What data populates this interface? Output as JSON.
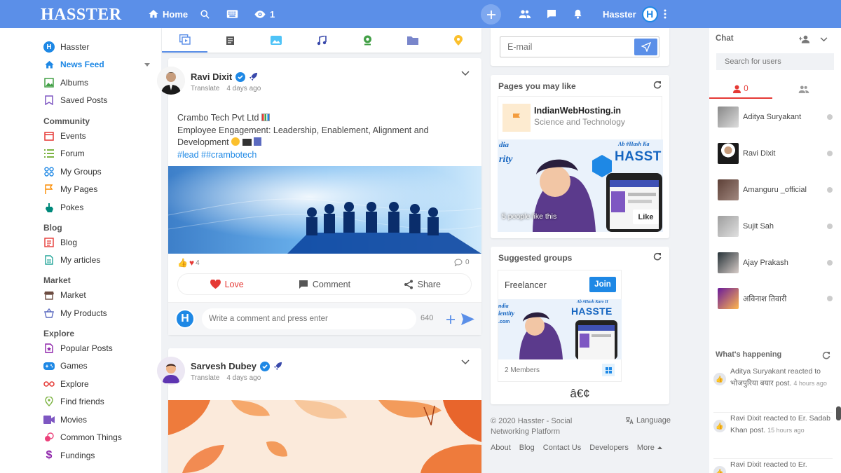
{
  "app": {
    "brand": "HASSTER"
  },
  "topbar": {
    "home_label": "Home",
    "views_count": "1",
    "user_name": "Hasster",
    "user_initial": "H"
  },
  "sidebar": {
    "profile": "Hasster",
    "news_feed": "News Feed",
    "albums": "Albums",
    "saved_posts": "Saved Posts",
    "community_heading": "Community",
    "events": "Events",
    "forum": "Forum",
    "my_groups": "My Groups",
    "my_pages": "My Pages",
    "pokes": "Pokes",
    "blog_heading": "Blog",
    "blog": "Blog",
    "my_articles": "My articles",
    "market_heading": "Market",
    "market": "Market",
    "my_products": "My Products",
    "explore_heading": "Explore",
    "popular_posts": "Popular Posts",
    "games": "Games",
    "explore": "Explore",
    "find_friends": "Find friends",
    "movies": "Movies",
    "common_things": "Common Things",
    "fundings": "Fundings"
  },
  "post1": {
    "author": "Ravi Dixit",
    "translate": "Translate",
    "time": "4 days ago",
    "line1": "Crambo Tech Pvt Ltd",
    "line2": "Employee Engagement: Leadership, Enablement, Alignment and",
    "line3": "Development",
    "hashtags": "#lead ##crambotech",
    "reaction_count": "4",
    "comment_count": "0",
    "love_label": "Love",
    "comment_label": "Comment",
    "share_label": "Share",
    "comment_placeholder": "Write a comment and press enter",
    "char_count": "640"
  },
  "post2": {
    "author": "Sarvesh Dubey",
    "translate": "Translate",
    "time": "4 days ago"
  },
  "email_box": {
    "placeholder": "E-mail"
  },
  "pages_like": {
    "title": "Pages you may like",
    "page_name": "IndianWebHosting.in",
    "page_category": "Science and Technology",
    "likes_text": "5 people like this",
    "like_button": "Like",
    "banner_tag": "Ab #Hash Ka",
    "banner_brand": "HASST",
    "banner_side1": "dia",
    "banner_side2": "rity"
  },
  "suggested_groups": {
    "title": "Suggested groups",
    "group_name": "Freelancer",
    "join_button": "Join",
    "members": "2 Members",
    "garbled": "â€¢",
    "banner_tag": "Ab #Hash Karo H",
    "banner_brand": "HASSTE",
    "banner_side1": "ndia",
    "banner_side2": "ientity",
    "banner_side3": ".com"
  },
  "footer": {
    "copyright": "© 2020 Hasster - Social Networking Platform",
    "language": "Language",
    "about": "About",
    "blog": "Blog",
    "contact": "Contact Us",
    "developers": "Developers",
    "more": "More"
  },
  "chat": {
    "title": "Chat",
    "search_placeholder": "Search for users",
    "online_count": "0",
    "users": [
      {
        "name": "Aditya Suryakant"
      },
      {
        "name": "Ravi Dixit"
      },
      {
        "name": "Amanguru _official"
      },
      {
        "name": "Sujit Sah"
      },
      {
        "name": "Ajay Prakash"
      },
      {
        "name": "अविनाश तिवारी"
      }
    ],
    "happening_title": "What's happening",
    "activities": [
      {
        "text": "Aditya Suryakant reacted to भोजपुरिया बयार post.",
        "time": "4 hours ago"
      },
      {
        "text": "Ravi Dixit reacted to Er. Sadab Khan post.",
        "time": "15 hours ago"
      },
      {
        "text": "Ravi Dixit reacted to Er.",
        "time": ""
      }
    ]
  },
  "colors": {
    "brand_blue": "#5b8fe8",
    "love_red": "#e53935",
    "link_blue": "#1e88e5"
  }
}
